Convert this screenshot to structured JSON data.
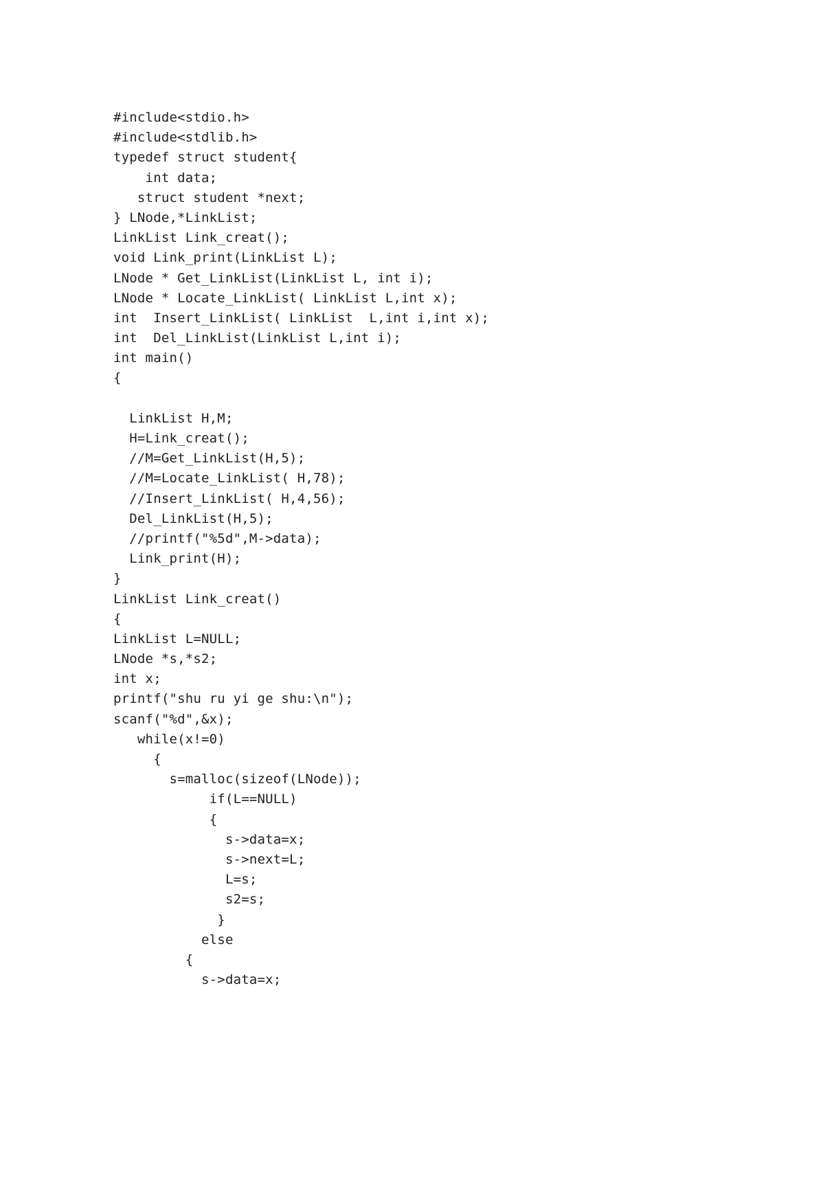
{
  "document": {
    "type": "code-listing",
    "language": "C",
    "page_background": "#ffffff",
    "text_color": "#231f20",
    "code_lines": [
      "#include<stdio.h>",
      "#include<stdlib.h>",
      "typedef struct student{",
      "    int data;",
      "   struct student *next;",
      "} LNode,*LinkList;",
      "LinkList Link_creat();",
      "void Link_print(LinkList L);",
      "LNode * Get_LinkList(LinkList L, int i);",
      "LNode * Locate_LinkList( LinkList L,int x);",
      "int  Insert_LinkList( LinkList  L,int i,int x);",
      "int  Del_LinkList(LinkList L,int i);",
      "int main()",
      "{",
      "",
      "  LinkList H,M;",
      "  H=Link_creat();",
      "  //M=Get_LinkList(H,5);",
      "  //M=Locate_LinkList( H,78);",
      "  //Insert_LinkList( H,4,56);",
      "  Del_LinkList(H,5);",
      "  //printf(\"%5d\",M->data);",
      "  Link_print(H);",
      "}",
      "LinkList Link_creat()",
      "{",
      "LinkList L=NULL;",
      "LNode *s,*s2;",
      "int x;",
      "printf(\"shu ru yi ge shu:\\n\");",
      "scanf(\"%d\",&x);",
      "   while(x!=0)",
      "     {",
      "       s=malloc(sizeof(LNode));",
      "            if(L==NULL)",
      "            {",
      "              s->data=x;",
      "              s->next=L;",
      "              L=s;",
      "              s2=s;",
      "             }",
      "           else",
      "         {",
      "           s->data=x;"
    ]
  }
}
